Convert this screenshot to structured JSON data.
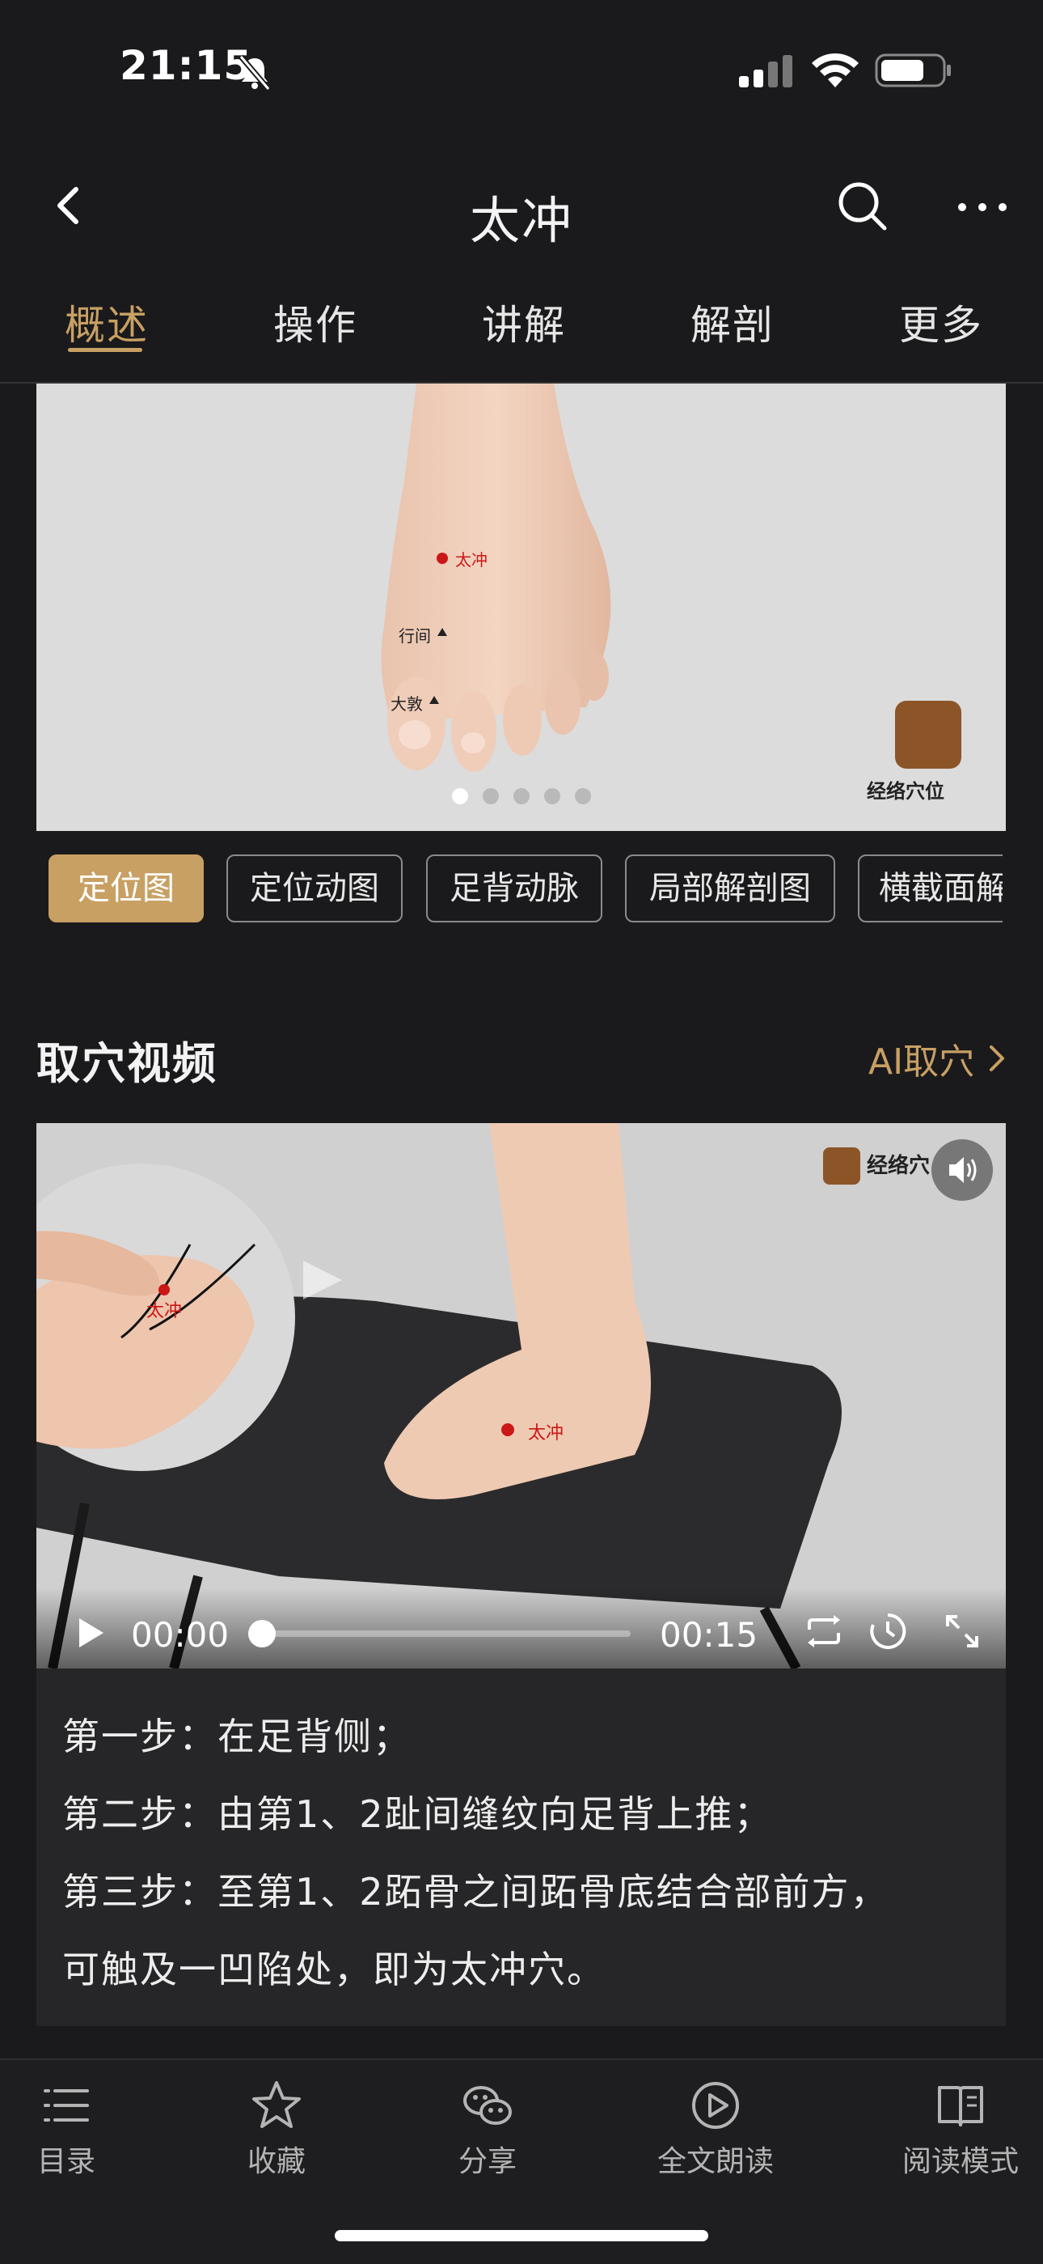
{
  "status": {
    "time": "21:15"
  },
  "nav": {
    "title": "太冲"
  },
  "tabs": [
    {
      "label": "概述",
      "active": true
    },
    {
      "label": "操作"
    },
    {
      "label": "讲解"
    },
    {
      "label": "解剖"
    },
    {
      "label": "更多"
    }
  ],
  "carousel": {
    "point_labels": {
      "main": "太冲",
      "p2": "行间",
      "p3": "大敦"
    },
    "brand_name": "经络穴位",
    "page_count": 5,
    "current_page": 1
  },
  "chips": [
    {
      "label": "定位图",
      "active": true
    },
    {
      "label": "定位动图"
    },
    {
      "label": "足背动脉"
    },
    {
      "label": "局部解剖图"
    },
    {
      "label": "横截面解"
    }
  ],
  "video_section": {
    "title": "取穴视频",
    "ai_link": "AI取穴",
    "overlay_label": "太冲",
    "overlay_label_2": "太冲",
    "logo_text": "经络穴",
    "current_time": "00:00",
    "duration": "00:15",
    "progress": 0
  },
  "steps": [
    "第一步：在足背侧；",
    "第二步：由第1、2趾间缝纹向足背上推；",
    "第三步：至第1、2跖骨之间跖骨底结合部前方，",
    "可触及一凹陷处，即为太冲穴。"
  ],
  "toolbar": [
    {
      "label": "目录",
      "icon": "list-icon"
    },
    {
      "label": "收藏",
      "icon": "star-icon"
    },
    {
      "label": "分享",
      "icon": "wechat-icon"
    },
    {
      "label": "全文朗读",
      "icon": "play-circle-icon"
    },
    {
      "label": "阅读模式",
      "icon": "book-icon"
    }
  ],
  "colors": {
    "accent": "#c8a063",
    "background": "#1a1a1c",
    "marker": "#cc1717"
  }
}
